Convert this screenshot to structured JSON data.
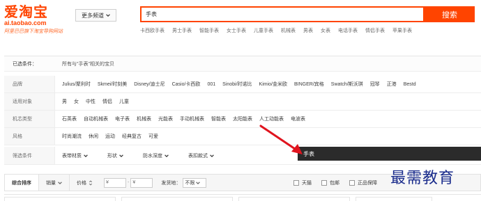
{
  "logo": {
    "title": "爱淘宝",
    "domain": "ai.taobao.com",
    "slogan": "阿里巴巴旗下淘宝导购网站"
  },
  "header": {
    "more_channels": "更多频道",
    "search_value": "手表",
    "search_button": "搜索",
    "hot_words": [
      "卡西欧手表",
      "男士手表",
      "智能手表",
      "女士手表",
      "儿童手表",
      "机械表",
      "男表",
      "女表",
      "电话手表",
      "情侣手表",
      "苹果手表"
    ]
  },
  "filters": {
    "selected_label": "已选条件：",
    "selected_text": "所有与\"手表\"相关的宝贝",
    "brand": {
      "label": "品牌",
      "options": [
        "Julius/聚利时",
        "Skmei/时刻美",
        "Disney/迪士尼",
        "Casio/卡西欧",
        "001",
        "Sinobi/时诺比",
        "Kimio/金米欧",
        "BINGER/宾格",
        "Swatch/斯沃琪",
        "冠琴",
        "正港",
        "Bestd"
      ]
    },
    "target": {
      "label": "适用对象",
      "options": [
        "男",
        "女",
        "中性",
        "情侣",
        "儿童"
      ]
    },
    "movement": {
      "label": "机芯类型",
      "options": [
        "石英表",
        "自动机械表",
        "电子表",
        "机械表",
        "光能表",
        "手动机械表",
        "智能表",
        "太阳能表",
        "人工动能表",
        "电波表"
      ]
    },
    "style": {
      "label": "风格",
      "options": [
        "时尚潮流",
        "休闲",
        "运动",
        "经典复古",
        "可爱"
      ]
    },
    "refine": {
      "label": "筛选条件",
      "dropdowns": [
        "表带材质",
        "形状",
        "防水深度",
        "表扣款式"
      ]
    },
    "tooltip_text": "手表"
  },
  "sortbar": {
    "default": "综合排序",
    "sales": "销量",
    "price": "价格",
    "price_from_placeholder": "¥",
    "price_to_placeholder": "¥",
    "price_dash": "-",
    "ship_from_label": "发货地：",
    "ship_from_value": "不限",
    "checks": [
      "天猫",
      "包邮",
      "正品保障"
    ]
  },
  "watermark": "最需教育",
  "colors": {
    "brand": "#ff4400",
    "arrow": "#e0141e",
    "tooltip_bg": "#2b2b2b",
    "watermark": "#1a2c8c"
  }
}
